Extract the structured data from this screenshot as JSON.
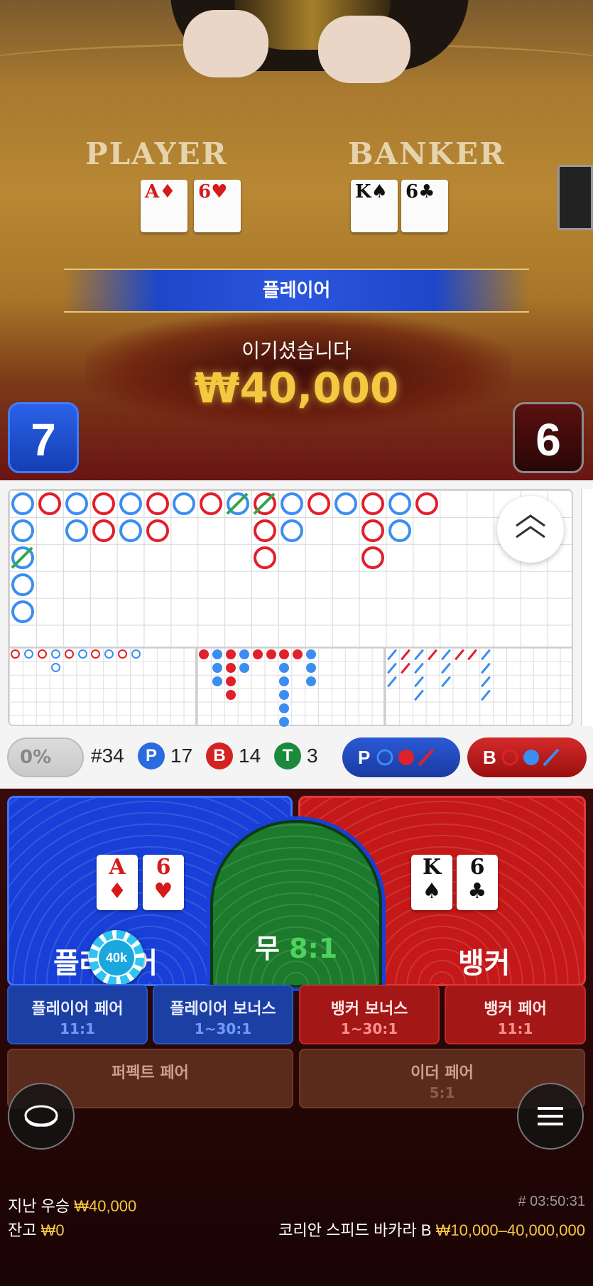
{
  "table": {
    "player_label": "PLAYER",
    "banker_label": "BANKER",
    "player_cards": [
      {
        "rank": "A",
        "suit": "♦",
        "color": "red"
      },
      {
        "rank": "6",
        "suit": "♥",
        "color": "red"
      }
    ],
    "banker_cards": [
      {
        "rank": "K",
        "suit": "♠",
        "color": "black"
      },
      {
        "rank": "6",
        "suit": "♣",
        "color": "black"
      }
    ]
  },
  "result": {
    "winner_label": "플레이어",
    "message": "이기셨습니다",
    "amount": "₩40,000",
    "player_score": "7",
    "banker_score": "6"
  },
  "roadmap": {
    "win_percent": "0%",
    "round": "#34",
    "player_badge": "P",
    "player_count": "17",
    "banker_badge": "B",
    "banker_count": "14",
    "tie_badge": "T",
    "tie_count": "3",
    "predict_player": "P",
    "predict_banker": "B"
  },
  "bets": {
    "player": "플레이어",
    "tie": "무",
    "tie_odds": "8:1",
    "banker": "뱅커",
    "chip": "40k",
    "player_pair": {
      "label": "플레이어 페어",
      "odds": "11:1"
    },
    "player_bonus": {
      "label": "플레이어 보너스",
      "odds": "1~30:1"
    },
    "banker_bonus": {
      "label": "뱅커 보너스",
      "odds": "1~30:1"
    },
    "banker_pair": {
      "label": "뱅커 페어",
      "odds": "11:1"
    },
    "perfect_pair": {
      "label": "퍼펙트 페어"
    },
    "either_pair": {
      "label": "이더 페어",
      "odds": "5:1"
    }
  },
  "footer": {
    "last_win_label": "지난 우승",
    "last_win_amount": "₩40,000",
    "balance_label": "잔고",
    "balance_amount": "₩0",
    "game_id": "# 03:50:31",
    "table_name": "코리안 스피드 바카라 B",
    "limits": "₩10,000–40,000,000"
  },
  "colors": {
    "player": "#1840d8",
    "banker": "#c51818",
    "tie": "#1c7a2c",
    "gold": "#f5c842"
  }
}
